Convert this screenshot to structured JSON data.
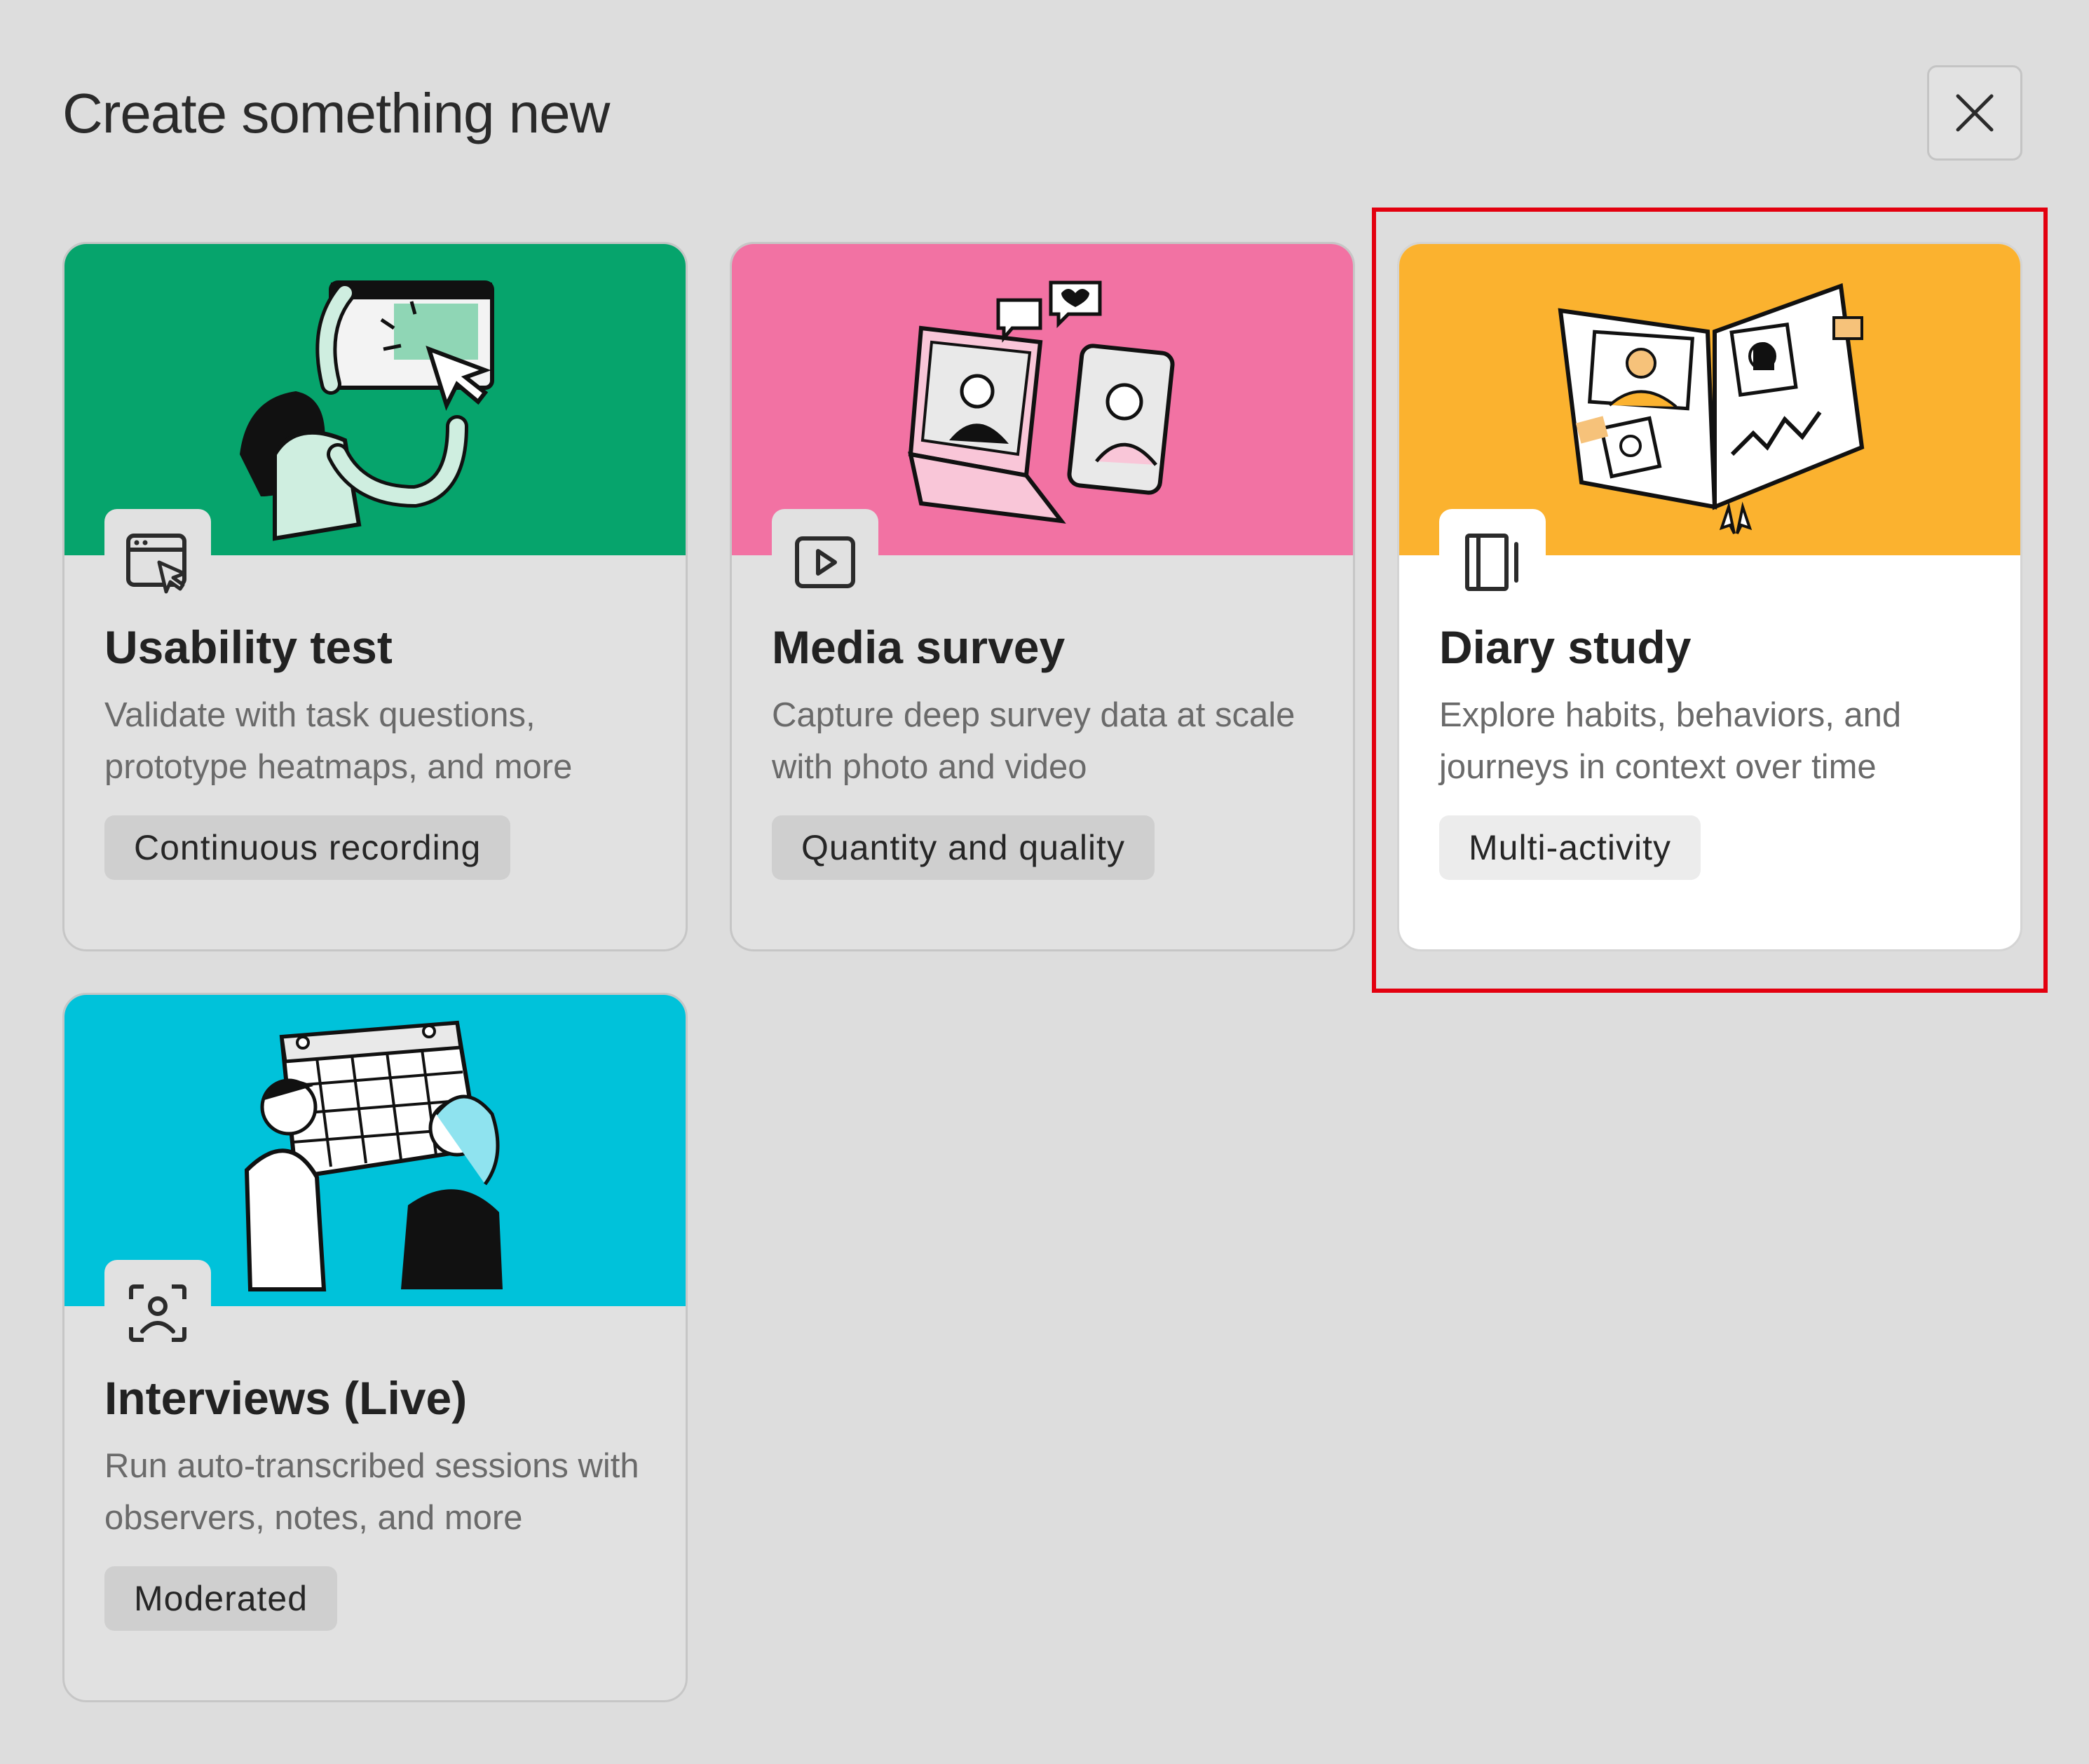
{
  "dialog": {
    "title": "Create something new",
    "close_icon": "close-icon"
  },
  "cards": [
    {
      "title": "Usability test",
      "description": "Validate with task questions, prototype heatmaps, and more",
      "tag": "Continuous recording",
      "icon": "browser-cursor-icon",
      "banner_color": "#06a46c",
      "selected": false
    },
    {
      "title": "Media survey",
      "description": "Capture deep survey data at scale with photo and video",
      "tag": "Quantity and quality",
      "icon": "play-video-icon",
      "banner_color": "#f272a3",
      "selected": false
    },
    {
      "title": "Diary study",
      "description": "Explore habits, behaviors, and journeys in context over time",
      "tag": "Multi-activity",
      "icon": "diary-book-icon",
      "banner_color": "#fbb22f",
      "selected": true
    },
    {
      "title": "Interviews (Live)",
      "description": "Run auto-transcribed sessions with observers, notes, and more",
      "tag": "Moderated",
      "icon": "person-focus-icon",
      "banner_color": "#00c2da",
      "selected": false
    }
  ],
  "highlight": {
    "color": "#e3000f",
    "target": "Diary study"
  }
}
